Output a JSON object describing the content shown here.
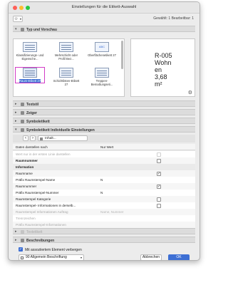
{
  "window": {
    "title": "Einstellungen für die Etikett-Auswahl"
  },
  "toolbar": {
    "selection_count": "Gewählt: 1 Bearbeitbar: 1"
  },
  "sections": {
    "typ": "Typ und Vorschau",
    "textstil": "Textstil",
    "zeiger": "Zeiger",
    "symbol": "Symboletikett",
    "individuell": "Symboletikett Individuelle Einstellungen",
    "textetikett": "Textetikett",
    "beschreibungen": "Beschreibungen"
  },
  "gallery": {
    "items": [
      {
        "label": "Klassifizierungs- und Eigensche..."
      },
      {
        "label": "Mehrschicht oder Profil Bez..."
      },
      {
        "label": "Oberflächenetikett 27"
      },
      {
        "label": "Raum-Etikett 27"
      },
      {
        "label": "Schichtlisten-Etikett 27"
      },
      {
        "label": "Treppen-Bemaßungseti..."
      }
    ],
    "abc_badge": "ABC"
  },
  "preview": {
    "text": [
      "R-005",
      "Wohn",
      "en",
      "3,68",
      "m²"
    ]
  },
  "icons": {
    "star": "☆",
    "gear": "⚙",
    "back": "‹",
    "forward": "›"
  },
  "inhalt": {
    "label": "Inhalt..."
  },
  "table": {
    "headers": [
      "Daten darstellen nach",
      "Nur Wert"
    ],
    "rows": [
      {
        "name": "Wert nur in der ersten Linie darstellen",
        "value": "",
        "check": false,
        "dim": true
      },
      {
        "name": "Raumnummer",
        "value": "",
        "check": false,
        "bold": true
      },
      {
        "name": "Information",
        "value": "",
        "check": null,
        "bold": true,
        "section": true
      },
      {
        "name": "Raumname",
        "value": "",
        "check": true
      },
      {
        "name": "Präfix Raumstempel-Name",
        "value": "N",
        "check": null
      },
      {
        "name": "Raumnummer",
        "value": "",
        "check": true
      },
      {
        "name": "Präfix Raumstempel-Nummer",
        "value": "N",
        "check": null
      },
      {
        "name": "Raumstempel Kategorie",
        "value": "",
        "check": false
      },
      {
        "name": "Raumstempel- Informationen in derselb...",
        "value": "",
        "check": false
      },
      {
        "name": "Raumstempel Informationen Auftrag",
        "value": "Name, Nummer",
        "check": null,
        "dim": true
      },
      {
        "name": "Trennzeichen",
        "value": "",
        "check": null,
        "dim": true
      },
      {
        "name": "Präfix Raumstempel-Informationen",
        "value": "",
        "check": null,
        "dim": true
      }
    ]
  },
  "footer": {
    "checkbox_label": "Mit assoziiertem Element verbergen",
    "layer": "90 Allgemein Beschriftung",
    "cancel": "Abbrechen",
    "ok": "OK"
  },
  "colors": {
    "accent": "#3d6fd4",
    "selection_outline": "#d23bc6"
  }
}
